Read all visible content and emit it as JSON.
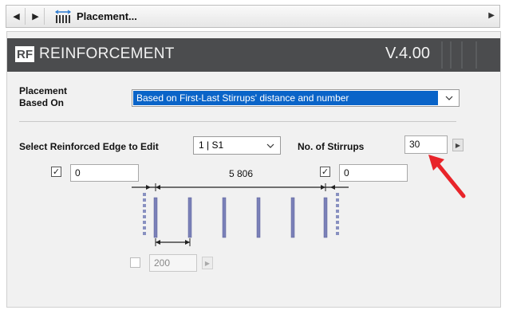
{
  "nav": {
    "title": "Placement...",
    "back_icon": "left-triangle-icon",
    "forward_icon": "right-triangle-icon"
  },
  "banner": {
    "logo": "RF",
    "title": "REINFORCEMENT",
    "version": "V.4.00"
  },
  "placement": {
    "label_line1": "Placement",
    "label_line2": "Based On",
    "selected_option": "Based on First-Last Stirrups' distance and number"
  },
  "edge": {
    "label": "Select Reinforced Edge to Edit",
    "value": "1 | S1"
  },
  "stirrups": {
    "label": "No. of Stirrups",
    "value": "30"
  },
  "diagram": {
    "left_offset": "0",
    "right_offset": "0",
    "total_length": "5 806",
    "spacing": "200"
  },
  "colors": {
    "accent": "#0a64c8",
    "banner": "#4b4c4e",
    "stirrup": "#7a80b8",
    "arrow": "#e8242a"
  }
}
